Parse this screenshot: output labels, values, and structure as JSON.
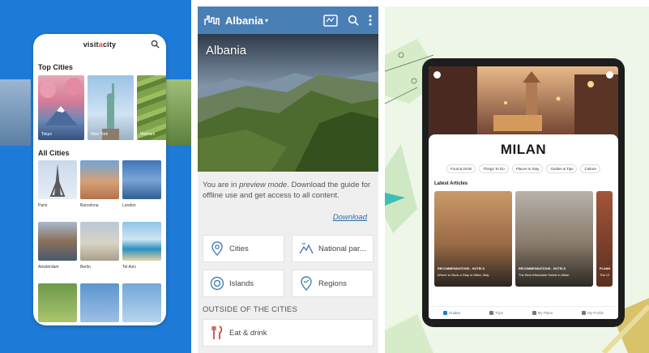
{
  "panel1": {
    "brand_pre": "visit",
    "brand_dot": "a",
    "brand_post": "city",
    "search_icon": "search-icon",
    "top_cities_heading": "Top Cities",
    "top_cities": [
      {
        "name": "Tokyo"
      },
      {
        "name": "New York"
      },
      {
        "name": "Vietnam"
      }
    ],
    "all_cities_heading": "All Cities",
    "all_cities": [
      {
        "name": "Paris"
      },
      {
        "name": "Barcelona"
      },
      {
        "name": "London"
      },
      {
        "name": "Amsterdam"
      },
      {
        "name": "Berlin"
      },
      {
        "name": "Tel Aviv"
      },
      {
        "name": ""
      },
      {
        "name": ""
      },
      {
        "name": ""
      }
    ]
  },
  "panel2": {
    "app_title": "Albania",
    "caret": "▾",
    "toolbar_icons": [
      "map-icon",
      "search-icon",
      "more-vert-icon"
    ],
    "hero_title": "Albania",
    "notice_prefix": "You are in ",
    "notice_em": "preview mode",
    "notice_suffix": ". Download the guide for offline use and get access to all content.",
    "download_label": "Download",
    "cards": [
      {
        "label": "Cities",
        "icon": "pin-icon"
      },
      {
        "label": "National par...",
        "icon": "mountain-icon"
      },
      {
        "label": "Islands",
        "icon": "lifebuoy-icon"
      },
      {
        "label": "Regions",
        "icon": "region-icon"
      }
    ],
    "section_heading": "OUTSIDE OF THE CITIES",
    "eat_label": "Eat & drink",
    "eat_icon": "fork-knife-icon"
  },
  "panel3": {
    "city": "MILAN",
    "chips": [
      "Food & Drink",
      "Things To Do",
      "Places to Stay",
      "Guides & Tips",
      "Culture"
    ],
    "latest_heading": "Latest Articles",
    "articles": [
      {
        "tag": "RECOMMENDATIONS - HOTELS",
        "headline": "Where to Book a Stay in Milan, Italy"
      },
      {
        "tag": "RECOMMENDATIONS - HOTELS",
        "headline": "The Best Affordable Hotels in Milan"
      },
      {
        "tag": "PLANN",
        "headline": "The Ul"
      }
    ],
    "tabs": [
      "Guides",
      "Trips",
      "My Plans",
      "My Profile"
    ],
    "active_tab": "Guides"
  }
}
